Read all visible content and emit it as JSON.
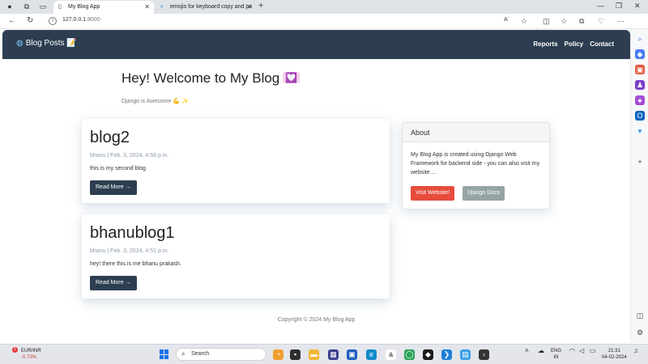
{
  "browser": {
    "tabs": [
      {
        "title": "My Blog App",
        "active": true
      },
      {
        "title": "emojis for keyboard copy and pa",
        "active": false
      }
    ],
    "address": {
      "host": "127.0.0.1",
      "port": ":8000"
    },
    "reader_icon_label": "Aʾ"
  },
  "navbar": {
    "brand": "Blog Posts",
    "brand_emoji": "📝",
    "links": [
      "Reports",
      "Policy",
      "Contact"
    ]
  },
  "hero": {
    "title": "Hey! Welcome to My Blog",
    "title_emoji": "💟",
    "subtitle": "Django is Awesome 💪 ✨"
  },
  "posts": [
    {
      "title": "blog2",
      "meta": "bhanu | Feb. 3, 2024, 4:58 p.m.",
      "body": "this is my second blog",
      "button": "Read More →"
    },
    {
      "title": "bhanublog1",
      "meta": "bhanu | Feb. 3, 2024, 4:51 p.m.",
      "body": "hey! there this is me bhanu prakash.",
      "button": "Read More →"
    }
  ],
  "about": {
    "heading": "About",
    "text": "My Blog App is created using Django Web Framework for backend side - you can also visit my website ...",
    "visit_button": "Visit Website!",
    "docs_button": "Django Docs"
  },
  "footer": "Copyright © 2024 My Blog App",
  "taskbar": {
    "ticker_name": "EUR/INR",
    "ticker_change": "-0.73%",
    "ticker_badge": "1",
    "search_placeholder": "Search",
    "lang": "ENG",
    "region": "IN",
    "time": "21:31",
    "date": "04-02-2024"
  },
  "colors": {
    "navbar": "#2c3e50",
    "visit_button": "#e74c3c",
    "docs_button": "#95a5a6"
  }
}
